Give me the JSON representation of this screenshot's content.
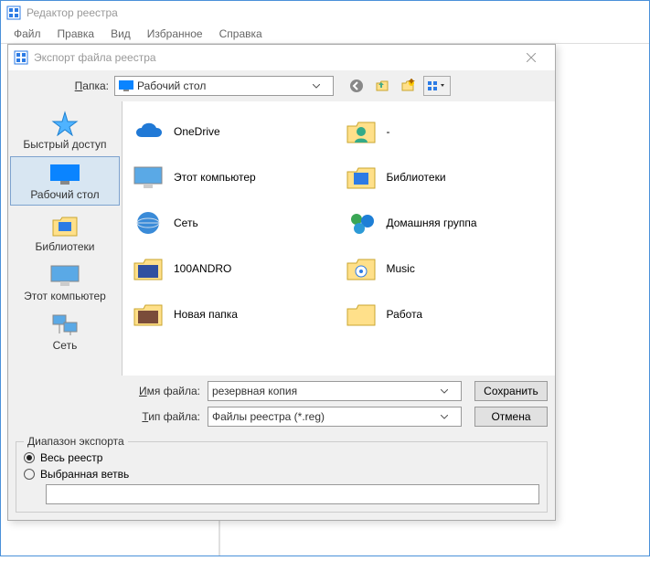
{
  "main": {
    "title": "Редактор реестра",
    "menu": [
      "Файл",
      "Правка",
      "Вид",
      "Избранное",
      "Справка"
    ]
  },
  "dialog": {
    "title": "Экспорт файла реестра",
    "folder_label_pre": "П",
    "folder_label_post": "апка:",
    "folder_value": "Рабочий стол",
    "sidebar": [
      {
        "label": "Быстрый доступ",
        "icon": "star"
      },
      {
        "label": "Рабочий стол",
        "icon": "desktop",
        "selected": true
      },
      {
        "label": "Библиотеки",
        "icon": "libraries"
      },
      {
        "label": "Этот компьютер",
        "icon": "computer"
      },
      {
        "label": "Сеть",
        "icon": "network"
      }
    ],
    "files_left": [
      {
        "label": "OneDrive",
        "icon": "cloud"
      },
      {
        "label": "Этот компьютер",
        "icon": "computer"
      },
      {
        "label": "Сеть",
        "icon": "network"
      },
      {
        "label": "100ANDRO",
        "icon": "folder-photo"
      },
      {
        "label": "Новая папка",
        "icon": "folder-face"
      }
    ],
    "files_right": [
      {
        "label": "-",
        "icon": "user-folder"
      },
      {
        "label": "Библиотеки",
        "icon": "libraries-big"
      },
      {
        "label": "Домашняя группа",
        "icon": "homegroup"
      },
      {
        "label": "Music",
        "icon": "folder-music"
      },
      {
        "label": "Работа",
        "icon": "folder"
      }
    ],
    "filename_label_pre": "И",
    "filename_label_post": "мя файла:",
    "filename_value": "резервная копия",
    "filetype_label_pre": "Т",
    "filetype_label_post": "ип файла:",
    "filetype_value": "Файлы реестра (*.reg)",
    "save_btn": "Сохранить",
    "cancel_btn": "Отмена",
    "range_legend": "Диапазон экспорта",
    "radio_all": "Весь реестр",
    "radio_branch": "Выбранная ветвь",
    "branch_value": ""
  }
}
